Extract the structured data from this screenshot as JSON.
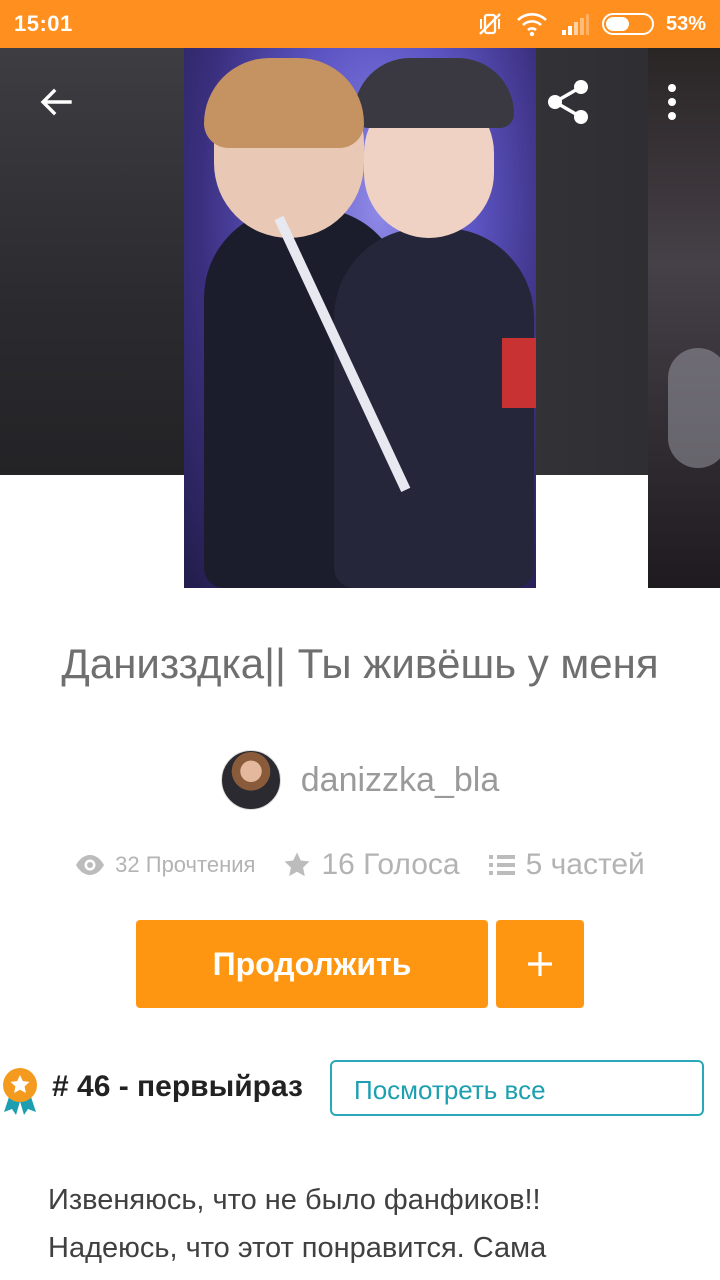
{
  "status_bar": {
    "time": "15:01",
    "battery_percent": "53%",
    "battery_level": 0.53,
    "icons": [
      "vibrate-off-icon",
      "wifi-icon",
      "signal-icon",
      "battery-icon"
    ]
  },
  "header": {
    "back_icon": "arrow-left-icon",
    "share_icon": "share-icon",
    "more_icon": "more-vertical-icon"
  },
  "story": {
    "title": "Данизздка|| Ты живёшь у меня",
    "author": "danizzka_bla",
    "reads": "32 Прочтения",
    "votes": "16 Голоса",
    "parts": "5 частей"
  },
  "actions": {
    "continue_label": "Продолжить",
    "add_label": "+"
  },
  "ranking": {
    "text": "# 46 - первыйраз",
    "view_all_label": "Посмотреть все"
  },
  "description": {
    "line1": "Извеняюсь, что не было фанфиков!!",
    "line2": "Надеюсь, что этот понравится. Сама"
  },
  "colors": {
    "accent": "#ff9612",
    "status_bar": "#ff8f1f",
    "link": "#1e9fb1"
  }
}
